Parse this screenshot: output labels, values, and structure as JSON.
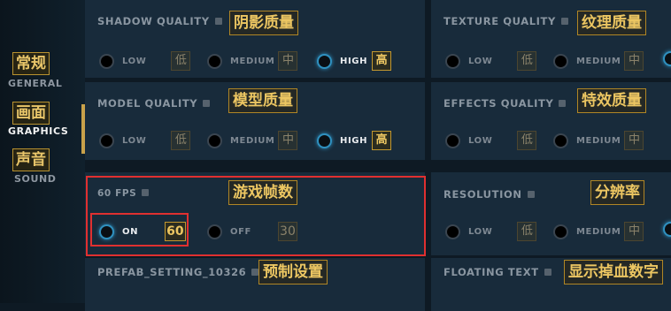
{
  "nav": {
    "items": [
      {
        "cn": "常规",
        "en": "GENERAL"
      },
      {
        "cn": "画面",
        "en": "GRAPHICS"
      },
      {
        "cn": "声音",
        "en": "SOUND"
      }
    ],
    "active": "GRAPHICS"
  },
  "settings": {
    "shadow_quality": {
      "title": "SHADOW QUALITY",
      "tag": "阴影质量",
      "options": [
        {
          "label": "LOW",
          "tag": "低"
        },
        {
          "label": "MEDIUM",
          "tag": "中"
        },
        {
          "label": "HIGH",
          "tag": "高"
        }
      ],
      "selected": "HIGH"
    },
    "texture_quality": {
      "title": "TEXTURE QUALITY",
      "tag": "纹理质量",
      "options": [
        {
          "label": "LOW",
          "tag": "低"
        },
        {
          "label": "MEDIUM",
          "tag": "中"
        }
      ]
    },
    "model_quality": {
      "title": "MODEL QUALITY",
      "tag": "模型质量",
      "options": [
        {
          "label": "LOW",
          "tag": "低"
        },
        {
          "label": "MEDIUM",
          "tag": "中"
        },
        {
          "label": "HIGH",
          "tag": "高"
        }
      ],
      "selected": "HIGH"
    },
    "effects_quality": {
      "title": "EFFECTS QUALITY",
      "tag": "特效质量",
      "options": [
        {
          "label": "LOW",
          "tag": "低"
        },
        {
          "label": "MEDIUM",
          "tag": "中"
        }
      ]
    },
    "fps": {
      "title": "60 FPS",
      "tag": "游戏帧数",
      "options": [
        {
          "label": "ON",
          "tag": "60"
        },
        {
          "label": "OFF",
          "tag": "30"
        }
      ],
      "selected": "ON"
    },
    "resolution": {
      "title": "RESOLUTION",
      "tag": "分辨率",
      "options": [
        {
          "label": "LOW",
          "tag": "低"
        },
        {
          "label": "MEDIUM",
          "tag": "中"
        }
      ]
    },
    "prefab_setting": {
      "title": "PREFAB_SETTING_10326",
      "tag": "预制设置"
    },
    "floating_text": {
      "title": "FLOATING TEXT",
      "tag": "显示掉血数字"
    }
  },
  "colors": {
    "accent_gold": "#ecc662",
    "radio_on": "#2f90bf",
    "highlight_box": "#e03030"
  }
}
